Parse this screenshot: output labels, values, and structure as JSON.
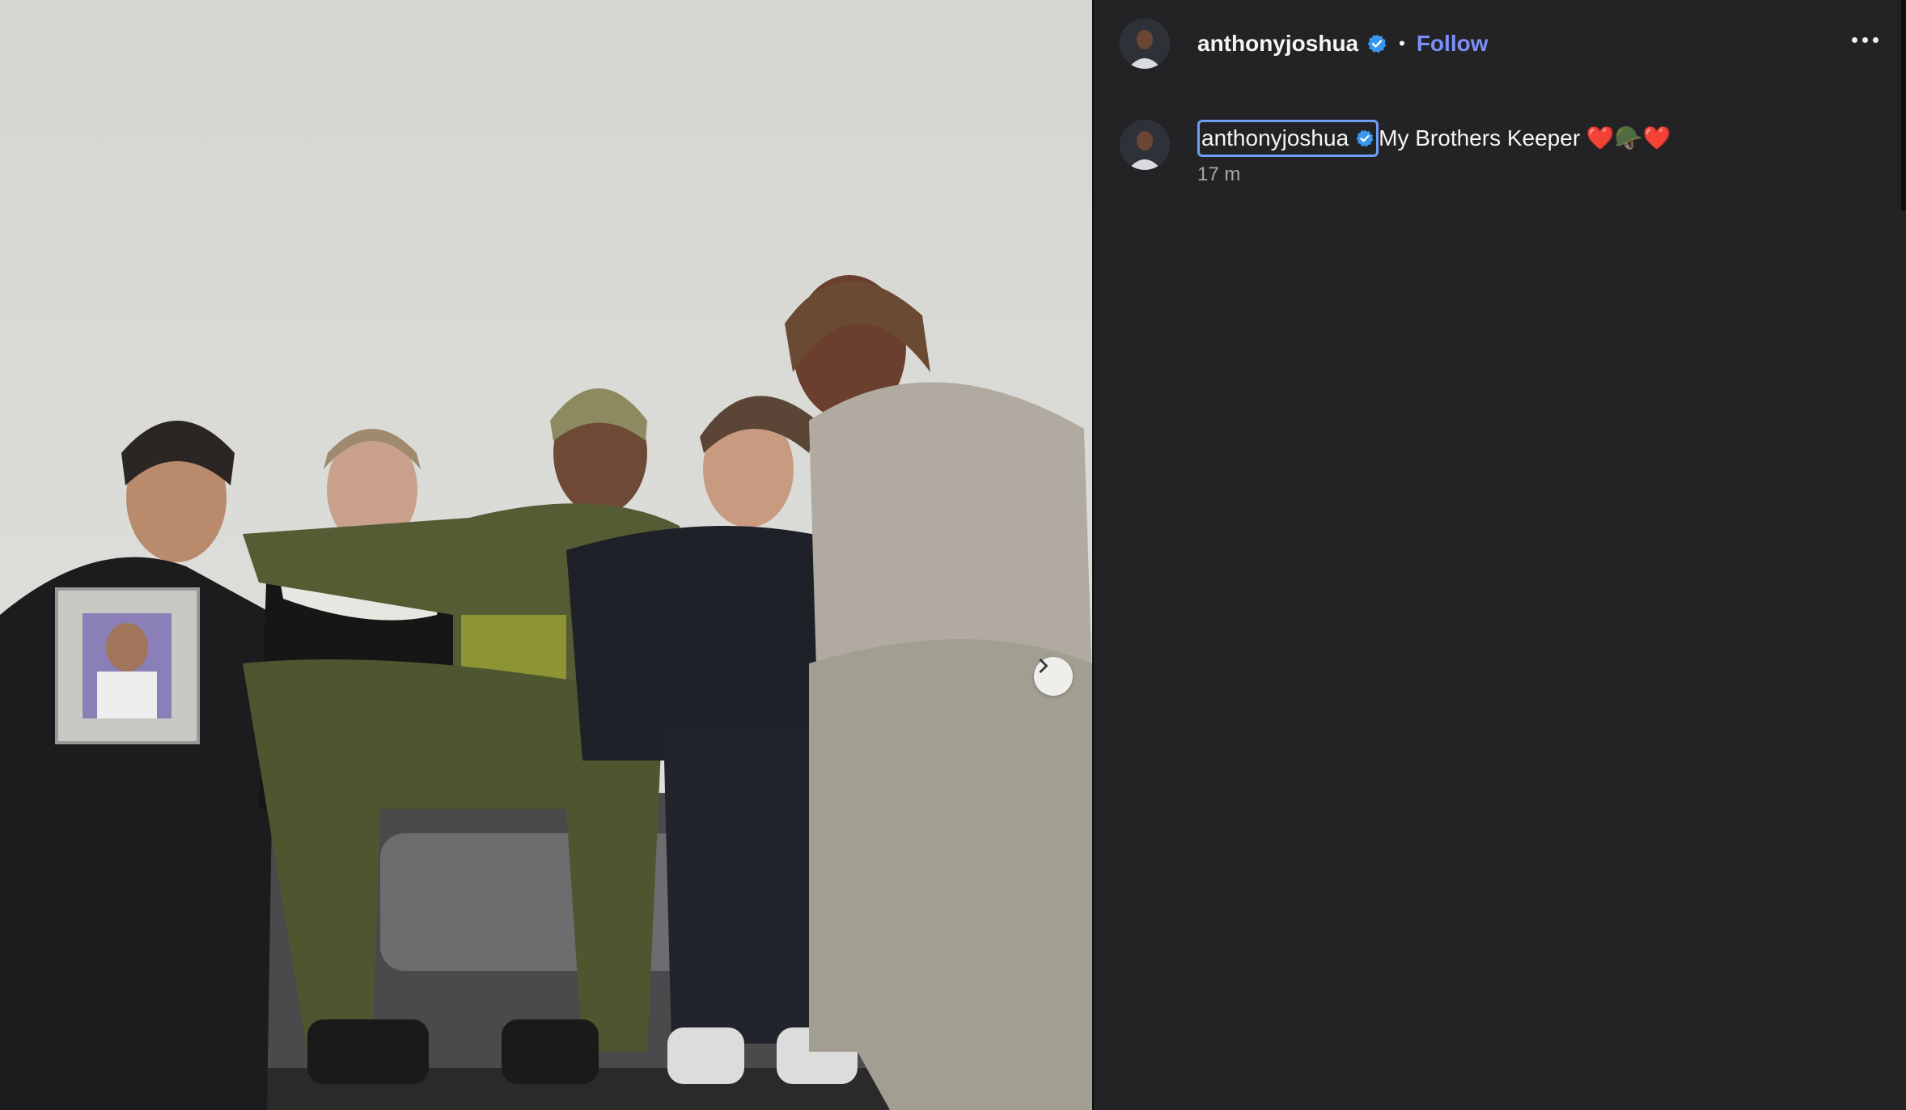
{
  "post": {
    "username": "anthonyjoshua",
    "follow_label": "Follow",
    "separator": "•",
    "caption_username": "anthonyjoshua",
    "caption_text": "My Brothers Keeper ❤️🪖❤️",
    "timestamp": "17 m"
  },
  "media": {
    "next_label": "Next"
  },
  "icons": {
    "verified": "verified-badge-icon",
    "more": "more-options-icon",
    "next": "chevron-right-icon"
  },
  "colors": {
    "follow": "#7b8ff7",
    "verified": "#3897f0",
    "panel_bg": "#232325",
    "caption_focus": "#6e9df5"
  }
}
